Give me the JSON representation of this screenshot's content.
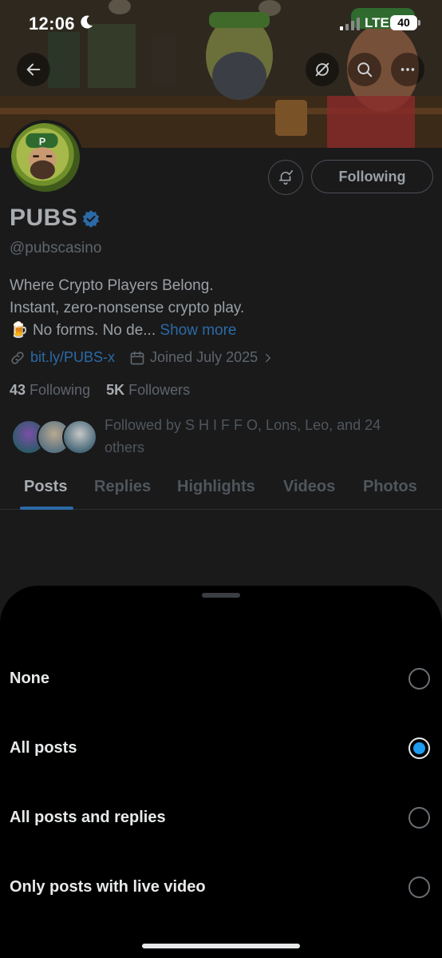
{
  "status_bar": {
    "time": "12:06",
    "network": "LTE",
    "battery": "40"
  },
  "banner": {
    "back_icon": "arrow-left-icon",
    "icons": [
      "grok-icon",
      "search-icon",
      "more-icon"
    ]
  },
  "profile": {
    "display_name": "PUBS",
    "handle": "@pubscasino",
    "bio_lines": [
      "Where Crypto Players Belong.",
      "Instant, zero-nonsense crypto play."
    ],
    "bio_emoji": "🍺",
    "bio_truncated": "No forms. No de...",
    "show_more": "Show more",
    "link": "bit.ly/PUBS-x",
    "joined": "Joined July 2025",
    "following_count": "43",
    "following_label": "Following",
    "followers_count": "5K",
    "followers_label": "Followers",
    "followed_by": "Followed by S H I F F O, Lons, Leo, and 24 others",
    "following_button": "Following"
  },
  "tabs": [
    "Posts",
    "Replies",
    "Highlights",
    "Videos",
    "Photos"
  ],
  "active_tab": "Posts",
  "sheet": {
    "options": [
      {
        "label": "None",
        "selected": false
      },
      {
        "label": "All posts",
        "selected": true
      },
      {
        "label": "All posts and replies",
        "selected": false
      },
      {
        "label": "Only posts with live video",
        "selected": false
      }
    ]
  },
  "colors": {
    "accent": "#1d9bf0",
    "link": "#2b6aa6",
    "sheet_background": "#000000"
  }
}
